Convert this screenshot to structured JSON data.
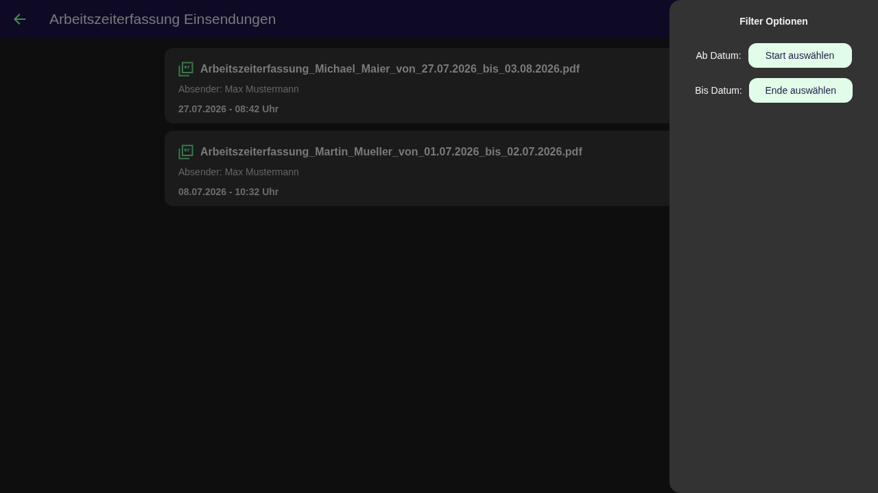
{
  "app_bar": {
    "title": "Arbeitszeiterfassung Einsendungen"
  },
  "submissions": [
    {
      "file_name": "Arbeitszeiterfassung_Michael_Maier_von_27.07.2026_bis_03.08.2026.pdf",
      "sender": "Absender: Max Mustermann",
      "timestamp": "27.07.2026 - 08:42 Uhr"
    },
    {
      "file_name": "Arbeitszeiterfassung_Martin_Mueller_von_01.07.2026_bis_02.07.2026.pdf",
      "sender": "Absender: Max Mustermann",
      "timestamp": "08.07.2026 - 10:32 Uhr"
    }
  ],
  "filter_drawer": {
    "title": "Filter Optionen",
    "fields": [
      {
        "label": "Ab Datum:",
        "button": "Start auswählen"
      },
      {
        "label": "Bis Datum:",
        "button": "Ende auswählen"
      }
    ]
  }
}
